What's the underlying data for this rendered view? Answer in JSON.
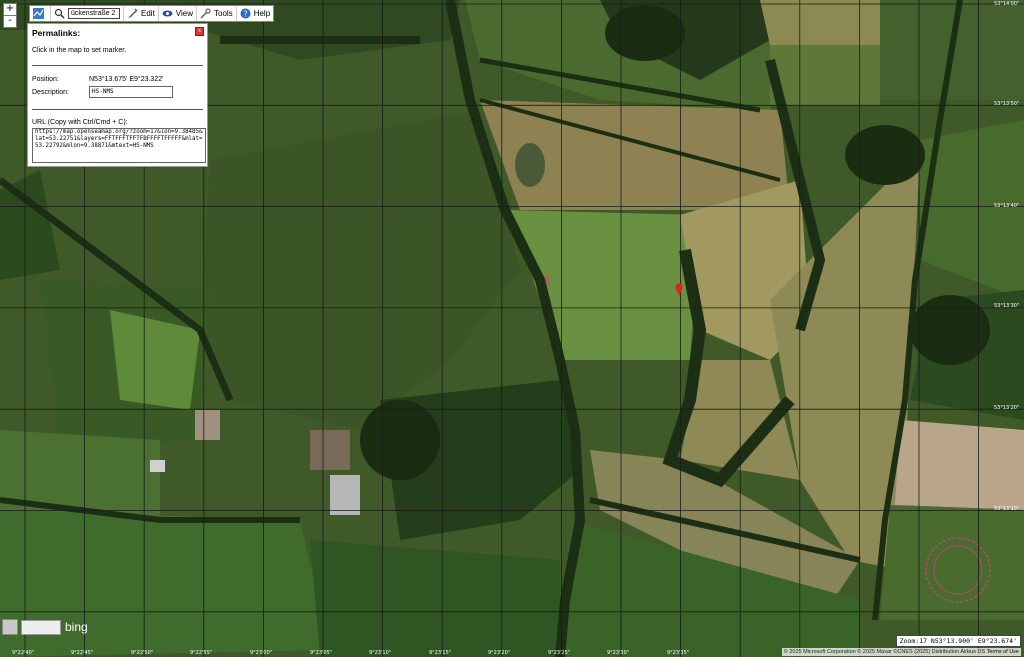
{
  "toolbar": {
    "search_value": "ückenstraße 2",
    "edit_label": "Edit",
    "view_label": "View",
    "tools_label": "Tools",
    "help_label": "Help"
  },
  "zoom": {
    "plus": "+",
    "minus": "-"
  },
  "permalink_panel": {
    "title": "Permalinks:",
    "close_glyph": "x",
    "hint": "Click in the map to set marker.",
    "position_label": "Position:",
    "position_value": "N53°13.675' E9°23.322'",
    "description_label": "Description:",
    "description_value": "HS-NMS",
    "url_label": "URL (Copy with Ctrl/Cmd + C):",
    "url_value": "https://map.openseamap.org/?zoom=17&lon=9.38485&lat=53.22751&layers=FFTFFFTFFTFBFFFFTFFFFF&mlat=53.22792&mlon=9.38871&mtext=HS-NMS"
  },
  "right_lat_labels": [
    "53°14'00\"",
    "53°13'50\"",
    "53°13'40\"",
    "53°13'30\"",
    "53°13'20\"",
    "53°13'10\""
  ],
  "bottom_lon_labels": [
    "9°22'40\"",
    "9°22'45\"",
    "9°22'50\"",
    "9°22'55\"",
    "9°23'00\"",
    "9°23'05\"",
    "9°23'10\"",
    "9°23'15\"",
    "9°23'20\"",
    "9°23'25\"",
    "9°23'30\"",
    "9°23'35\""
  ],
  "zoom_info": "Zoom:17 N53°13.900' E9°23.674'",
  "attribution": "© 2025 Microsoft Corporation © 2025 Maxar ©CNES (2025) Distribution Airbus DS",
  "terms_of_use": "Terms of Use",
  "bing_logo": "bing",
  "colors": {
    "marker": "#e02020",
    "grid": "#1a1a1a"
  }
}
